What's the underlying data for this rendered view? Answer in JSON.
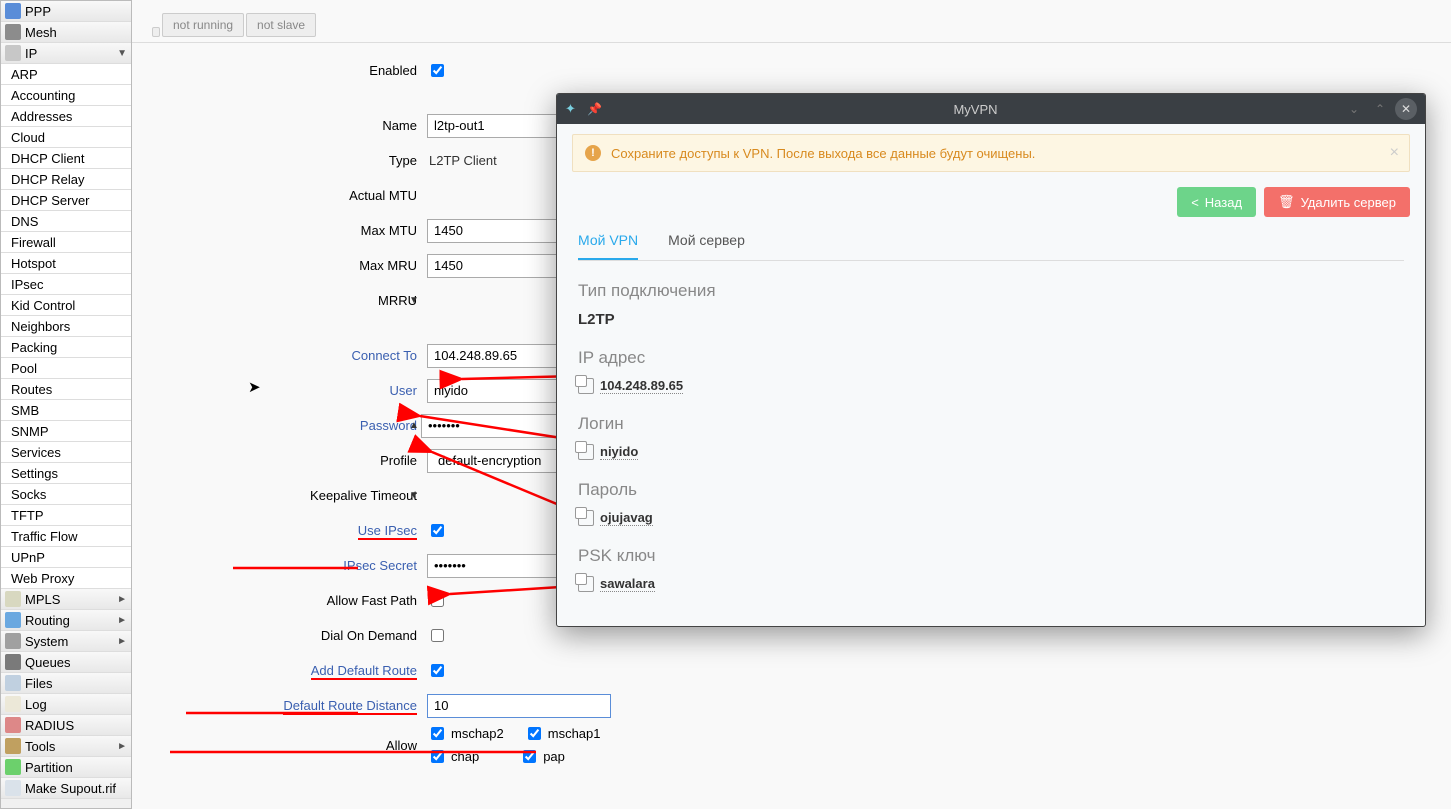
{
  "sidebar": {
    "top": [
      {
        "label": "PPP",
        "ico": "ppp",
        "arrow": false
      },
      {
        "label": "Mesh",
        "ico": "mesh",
        "arrow": false
      }
    ],
    "ip_label": "IP",
    "ip_items": [
      "ARP",
      "Accounting",
      "Addresses",
      "Cloud",
      "DHCP Client",
      "DHCP Relay",
      "DHCP Server",
      "DNS",
      "Firewall",
      "Hotspot",
      "IPsec",
      "Kid Control",
      "Neighbors",
      "Packing",
      "Pool",
      "Routes",
      "SMB",
      "SNMP",
      "Services",
      "Settings",
      "Socks",
      "TFTP",
      "Traffic Flow",
      "UPnP",
      "Web Proxy"
    ],
    "bottom": [
      {
        "label": "MPLS",
        "ico": "mpls",
        "arrow": true
      },
      {
        "label": "Routing",
        "ico": "routing",
        "arrow": true
      },
      {
        "label": "System",
        "ico": "system",
        "arrow": true
      },
      {
        "label": "Queues",
        "ico": "queues",
        "arrow": false
      },
      {
        "label": "Files",
        "ico": "files",
        "arrow": false
      },
      {
        "label": "Log",
        "ico": "log",
        "arrow": false
      },
      {
        "label": "RADIUS",
        "ico": "radius",
        "arrow": false
      },
      {
        "label": "Tools",
        "ico": "tools",
        "arrow": true
      },
      {
        "label": "Partition",
        "ico": "partition",
        "arrow": false
      },
      {
        "label": "Make Supout.rif",
        "ico": "supout",
        "arrow": false
      }
    ]
  },
  "tags": {
    "t1": "not running",
    "t2": "not slave"
  },
  "form": {
    "enabled_label": "Enabled",
    "enabled": true,
    "name_label": "Name",
    "name": "l2tp-out1",
    "type_label": "Type",
    "type": "L2TP Client",
    "actual_mtu_label": "Actual MTU",
    "max_mtu_label": "Max MTU",
    "max_mtu": "1450",
    "max_mru_label": "Max MRU",
    "max_mru": "1450",
    "mrru_label": "MRRU",
    "connect_to_label": "Connect To",
    "connect_to": "104.248.89.65",
    "user_label": "User",
    "user": "niyido",
    "password_label": "Password",
    "password": "•••••••",
    "profile_label": "Profile",
    "profile": "default-encryption",
    "keepalive_label": "Keepalive Timeout",
    "use_ipsec_label": "Use IPsec",
    "use_ipsec": true,
    "ipsec_secret_label": "IPsec Secret",
    "ipsec_secret": "•••••••",
    "allow_fast_path_label": "Allow Fast Path",
    "allow_fast_path": false,
    "dial_on_demand_label": "Dial On Demand",
    "dial_on_demand": false,
    "add_default_route_label": "Add Default Route",
    "add_default_route": true,
    "default_route_distance_label": "Default Route Distance",
    "default_route_distance": "10",
    "allow_label": "Allow",
    "allow_opts": {
      "mschap2": "mschap2",
      "mschap1": "mschap1",
      "chap": "chap",
      "pap": "pap"
    }
  },
  "dialog": {
    "title": "MyVPN",
    "alert": "Сохраните доступы к VPN. После выхода все данные будут очищены.",
    "back_btn": "Назад",
    "delete_btn": "Удалить сервер",
    "tab1": "Мой VPN",
    "tab2": "Мой сервер",
    "conn_type_label": "Тип подключения",
    "conn_type": "L2TP",
    "ip_label": "IP адрес",
    "ip": "104.248.89.65",
    "login_label": "Логин",
    "login": "niyido",
    "password_label": "Пароль",
    "password": "ojujavag",
    "psk_label": "PSK ключ",
    "psk": "sawalara"
  }
}
